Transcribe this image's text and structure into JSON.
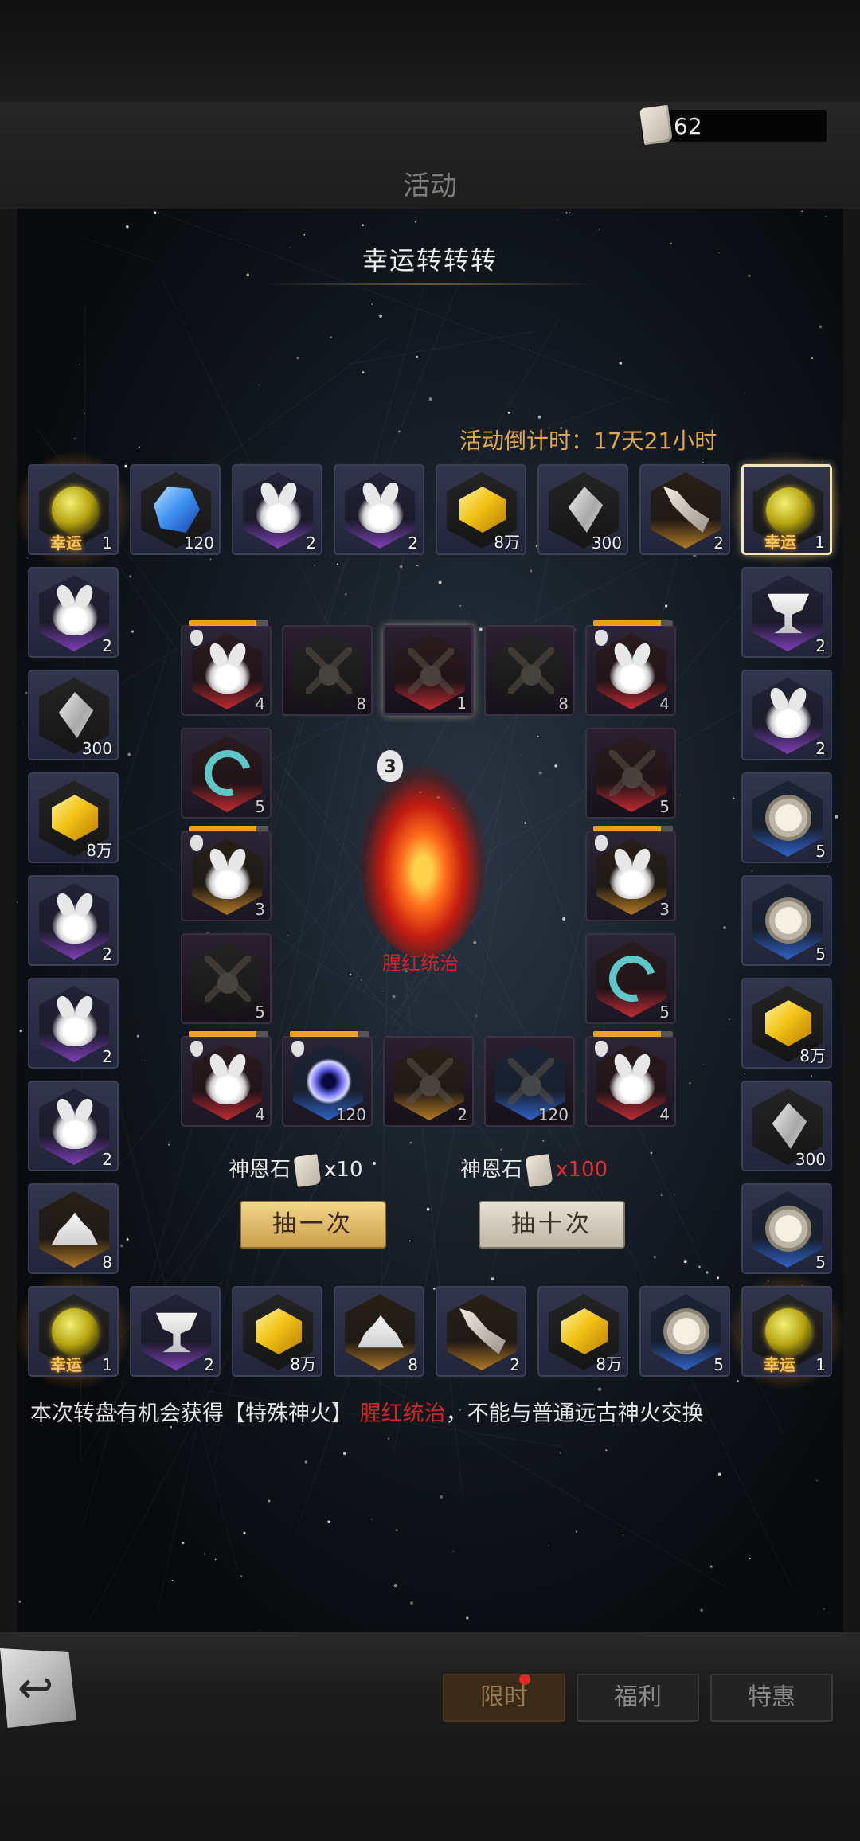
{
  "header": {
    "currency_value": "62",
    "page_title": "活动"
  },
  "event": {
    "title": "幸运转转转",
    "countdown_label": "活动倒计时：",
    "countdown_value": "17天21小时"
  },
  "lucky_label": "幸运",
  "ring": {
    "top": [
      {
        "icon": "orb-icon",
        "frame": "dark",
        "qty": "1",
        "lucky": true
      },
      {
        "icon": "gem-blue-icon",
        "frame": "dark",
        "qty": "120"
      },
      {
        "icon": "flame-icon",
        "frame": "purple",
        "qty": "2"
      },
      {
        "icon": "flame-icon",
        "frame": "purple",
        "qty": "2"
      },
      {
        "icon": "gem-yellow-icon",
        "frame": "dark",
        "qty": "8万"
      },
      {
        "icon": "crystal-icon",
        "frame": "dark",
        "qty": "300"
      },
      {
        "icon": "branch-icon",
        "frame": "gold",
        "qty": "2"
      },
      {
        "icon": "orb-icon",
        "frame": "dark",
        "qty": "1",
        "lucky": true,
        "selected": true
      }
    ],
    "left": [
      {
        "icon": "flame-icon",
        "frame": "purple",
        "qty": "2"
      },
      {
        "icon": "crystal-icon",
        "frame": "dark",
        "qty": "300"
      },
      {
        "icon": "gem-yellow-icon",
        "frame": "dark",
        "qty": "8万"
      },
      {
        "icon": "flame-icon",
        "frame": "purple",
        "qty": "2"
      },
      {
        "icon": "flame-icon",
        "frame": "purple",
        "qty": "2"
      },
      {
        "icon": "flame-icon",
        "frame": "purple",
        "qty": "2"
      },
      {
        "icon": "powder-icon",
        "frame": "gold",
        "qty": "8"
      }
    ],
    "right": [
      {
        "icon": "chalice-icon",
        "frame": "purple",
        "qty": "2"
      },
      {
        "icon": "flame-icon",
        "frame": "purple",
        "qty": "2"
      },
      {
        "icon": "compass-icon",
        "frame": "blue",
        "qty": "5"
      },
      {
        "icon": "compass-icon",
        "frame": "blue",
        "qty": "5"
      },
      {
        "icon": "gem-yellow-icon",
        "frame": "dark",
        "qty": "8万"
      },
      {
        "icon": "crystal-icon",
        "frame": "dark",
        "qty": "300"
      },
      {
        "icon": "compass-icon",
        "frame": "blue",
        "qty": "5"
      }
    ],
    "bottom": [
      {
        "icon": "orb-icon",
        "frame": "dark",
        "qty": "1",
        "lucky": true
      },
      {
        "icon": "chalice-icon",
        "frame": "purple",
        "qty": "2"
      },
      {
        "icon": "gem-yellow-icon",
        "frame": "dark",
        "qty": "8万"
      },
      {
        "icon": "powder-icon",
        "frame": "gold",
        "qty": "8"
      },
      {
        "icon": "branch-icon",
        "frame": "gold",
        "qty": "2"
      },
      {
        "icon": "gem-yellow-icon",
        "frame": "dark",
        "qty": "8万"
      },
      {
        "icon": "compass-icon",
        "frame": "blue",
        "qty": "5"
      },
      {
        "icon": "orb-icon",
        "frame": "dark",
        "qty": "1",
        "lucky": true
      }
    ]
  },
  "inner": {
    "row1": [
      {
        "icon": "flame-icon",
        "frame": "red",
        "qty": "4",
        "progress": true
      },
      {
        "icon": "lock-icon",
        "frame": "dark",
        "qty": "8",
        "dim": true
      },
      {
        "icon": "lock-icon",
        "frame": "red",
        "qty": "1",
        "dim": true,
        "selected": true
      },
      {
        "icon": "lock-icon",
        "frame": "dark",
        "qty": "8",
        "dim": true
      },
      {
        "icon": "flame-icon",
        "frame": "red",
        "qty": "4",
        "progress": true
      }
    ],
    "left": [
      {
        "icon": "ring-icon",
        "frame": "red",
        "qty": "5"
      },
      {
        "icon": "flame-icon",
        "frame": "gold",
        "qty": "3",
        "progress": true
      },
      {
        "icon": "lock-icon",
        "frame": "dark",
        "qty": "5",
        "dim": true
      }
    ],
    "right": [
      {
        "icon": "lock-icon",
        "frame": "red",
        "qty": "5",
        "dim": true
      },
      {
        "icon": "flame-icon",
        "frame": "gold",
        "qty": "3",
        "progress": true
      },
      {
        "icon": "ring-icon",
        "frame": "red",
        "qty": "5"
      }
    ],
    "row5": [
      {
        "icon": "flame-icon",
        "frame": "red",
        "qty": "4",
        "progress": true
      },
      {
        "icon": "vortex-icon",
        "frame": "blue",
        "qty": "120",
        "progress": true
      },
      {
        "icon": "lock-icon",
        "frame": "gold",
        "qty": "2",
        "dim": true
      },
      {
        "icon": "lock-icon",
        "frame": "blue",
        "qty": "120",
        "dim": true
      },
      {
        "icon": "flame-icon",
        "frame": "red",
        "qty": "4",
        "progress": true
      }
    ]
  },
  "center": {
    "fire_count": "3",
    "fire_name": "腥红统治"
  },
  "draw": {
    "cost_label": "神恩石",
    "single_cost": "x10",
    "ten_cost": "x100",
    "single_button": "抽一次",
    "ten_button": "抽十次"
  },
  "description": {
    "part1": "本次转盘有机会获得【特殊神火】",
    "highlight": "腥红统治",
    "part2": "，不能与普通远古神火交换"
  },
  "tabs": {
    "limited": "限时",
    "welfare": "福利",
    "special": "特惠"
  }
}
